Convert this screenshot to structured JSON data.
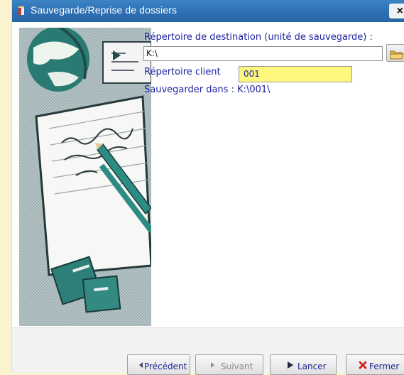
{
  "window": {
    "title": "Sauvegarde/Reprise de dossiers",
    "close_glyph": "×"
  },
  "form": {
    "destination_label": "Répertoire de destination (unité de sauvegarde) :",
    "destination_value": "K:\\",
    "client_label": "Répertoire client",
    "client_value": "001",
    "save_into": "Sauvegarder dans : K:\\001\\"
  },
  "buttons": {
    "previous": {
      "label": "Précédent",
      "enabled": true
    },
    "next": {
      "label": "Suivant",
      "enabled": false
    },
    "run": {
      "label": "Lancer",
      "enabled": true
    },
    "close": {
      "label": "Fermer",
      "enabled": true
    }
  },
  "icons": {
    "title": "app-icon",
    "illustration": "globe-notebook-pencil-books-illustration",
    "browse": "folder-icon",
    "previous": "triangle-left-icon",
    "next": "triangle-right-icon",
    "run": "play-icon",
    "close": "red-x-icon"
  },
  "colors": {
    "titlebar": "#2f73b6",
    "label_text": "#1b1f9e",
    "client_field": "#fdf77d",
    "page_background": "#fbf3cf",
    "close_button_icon": "#d02020"
  }
}
